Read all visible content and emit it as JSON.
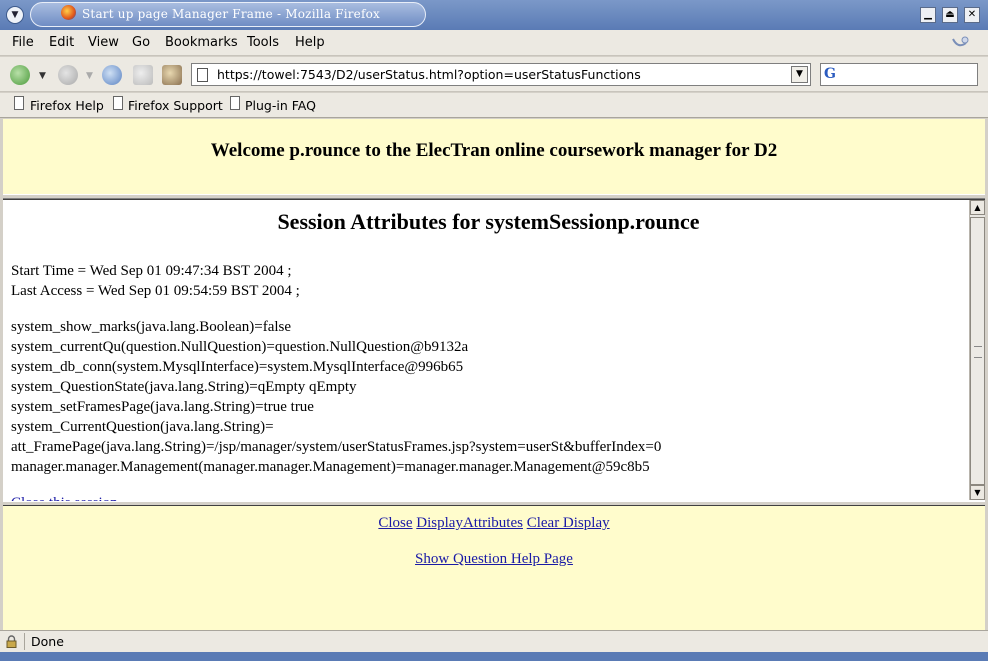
{
  "window": {
    "title": "Start up page Manager Frame - Mozilla Firefox"
  },
  "menu": [
    "File",
    "Edit",
    "View",
    "Go",
    "Bookmarks",
    "Tools",
    "Help"
  ],
  "nav": {
    "url": "https://towel:7543/D2/userStatus.html?option=userStatusFunctions",
    "search_placeholder": ""
  },
  "bookmarks": [
    "Firefox Help",
    "Firefox Support",
    "Plug-in FAQ"
  ],
  "top_frame": {
    "welcome": "Welcome p.rounce to the ElecTran online coursework manager for D2"
  },
  "session": {
    "title": "Session Attributes for systemSessionp.rounce",
    "start_time": "Start Time = Wed Sep 01 09:47:34 BST 2004 ;",
    "last_access": "Last Access = Wed Sep 01 09:54:59 BST 2004 ;",
    "attributes": [
      "system_show_marks(java.lang.Boolean)=false",
      "system_currentQu(question.NullQuestion)=question.NullQuestion@b9132a",
      "system_db_conn(system.MysqlInterface)=system.MysqlInterface@996b65",
      "system_QuestionState(java.lang.String)=qEmpty qEmpty",
      "system_setFramesPage(java.lang.String)=true true",
      "system_CurrentQuestion(java.lang.String)=",
      "att_FramePage(java.lang.String)=/jsp/manager/system/userStatusFrames.jsp?system=userSt&bufferIndex=0",
      "manager.manager.Management(manager.manager.Management)=manager.manager.Management@59c8b5"
    ],
    "close_link": "Close this session"
  },
  "bottom_frame": {
    "close": "Close",
    "display_attributes": "DisplayAttributes",
    "clear_display": "Clear Display",
    "help": "Show Question Help Page"
  },
  "status": {
    "text": "Done"
  },
  "colors": {
    "frame_bg": "#fffccc",
    "link": "#1a1aa6",
    "titlebar": "#5a7bb5"
  }
}
